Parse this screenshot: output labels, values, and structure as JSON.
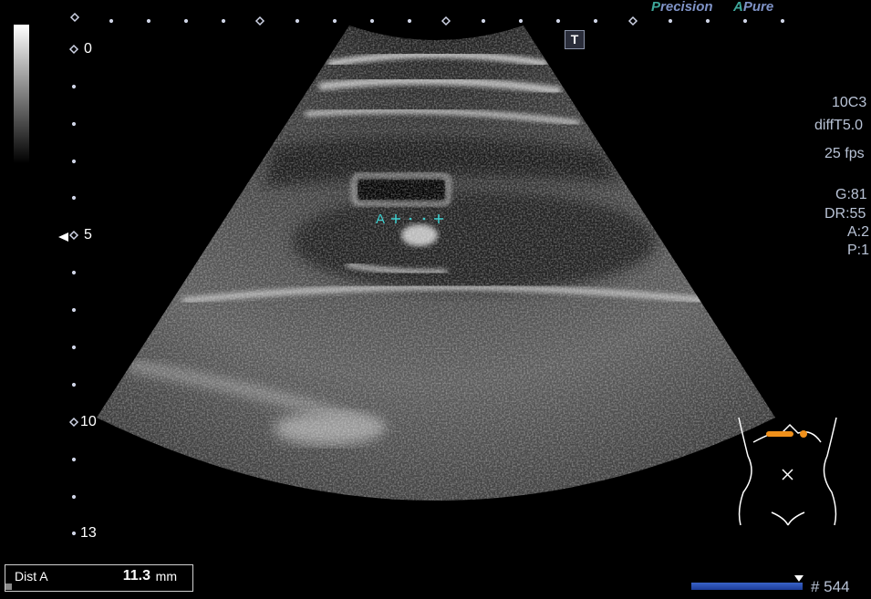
{
  "brand": {
    "precision_p": "P",
    "precision_rest": "recision",
    "apure_a": "A",
    "apure_rest": "Pure"
  },
  "toolbar": {
    "t_button": "T"
  },
  "depth_scale": {
    "marks": [
      "0",
      "5",
      "10",
      "13"
    ]
  },
  "params": {
    "probe": "10C3",
    "preset": "diffT5.0",
    "frame_rate": "25 fps",
    "gain": "G:81",
    "dynamic_range": "DR:55",
    "a_value": "A:2",
    "p_value": "P:1"
  },
  "caliper": {
    "label": "A"
  },
  "measurement": {
    "label": "Dist A",
    "value": "11.3",
    "unit": "mm"
  },
  "cine": {
    "frame_counter": "# 544"
  },
  "colors": {
    "caliper": "#3fd0d0",
    "body_marker": "#f0901a",
    "cine_bar": "#2d55c0"
  }
}
